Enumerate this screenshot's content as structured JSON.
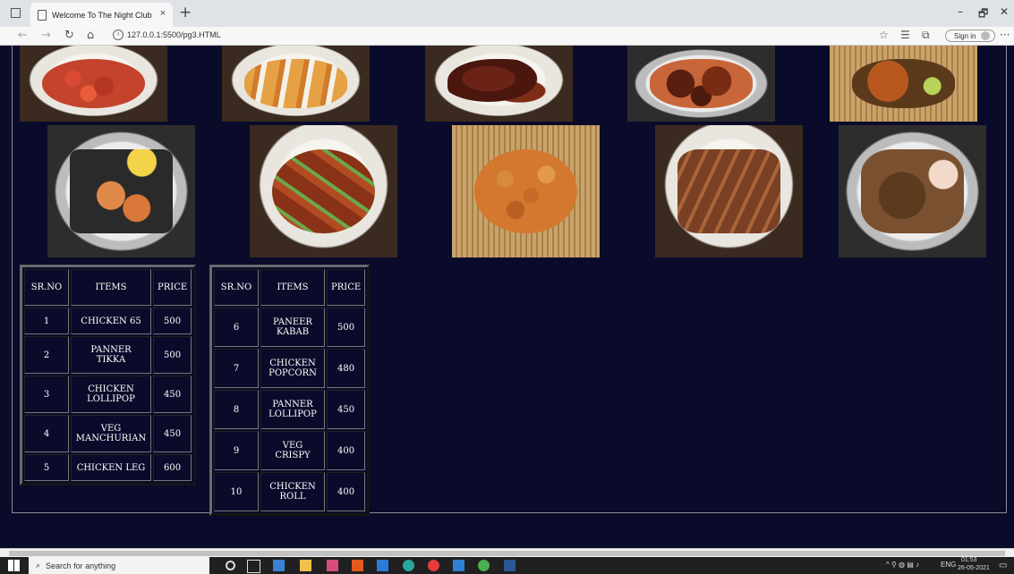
{
  "browser": {
    "tab_title": "Welcome To The Night Club",
    "tab_close": "×",
    "new_tab": "+",
    "url": "127.0.0.1:5500/pg3.HTML",
    "sign_in": "Sign in",
    "window_min": "–",
    "window_max": "🗗",
    "window_close": "✕",
    "more": "···"
  },
  "table1": {
    "headers": [
      "SR.NO",
      "ITEMS",
      "PRICE"
    ],
    "rows": [
      [
        "1",
        "CHICKEN 65",
        "500"
      ],
      [
        "2",
        "PANNER TIKKA",
        "500"
      ],
      [
        "3",
        "CHICKEN LOLLIPOP",
        "450"
      ],
      [
        "4",
        "VEG MANCHURIAN",
        "450"
      ],
      [
        "5",
        "CHICKEN LEG",
        "600"
      ]
    ]
  },
  "table2": {
    "headers": [
      "SR.NO",
      "ITEMS",
      "PRICE"
    ],
    "rows": [
      [
        "6",
        "PANEER KABAB",
        "500"
      ],
      [
        "7",
        "CHICKEN POPCORN",
        "480"
      ],
      [
        "8",
        "PANNER LOLLIPOP",
        "450"
      ],
      [
        "9",
        "VEG CRISPY",
        "400"
      ],
      [
        "10",
        "CHICKEN ROLL",
        "400"
      ]
    ]
  },
  "taskbar": {
    "search_placeholder": "Search for anything",
    "lang": "ENG",
    "time": "01:53",
    "date": "26-05-2021"
  }
}
